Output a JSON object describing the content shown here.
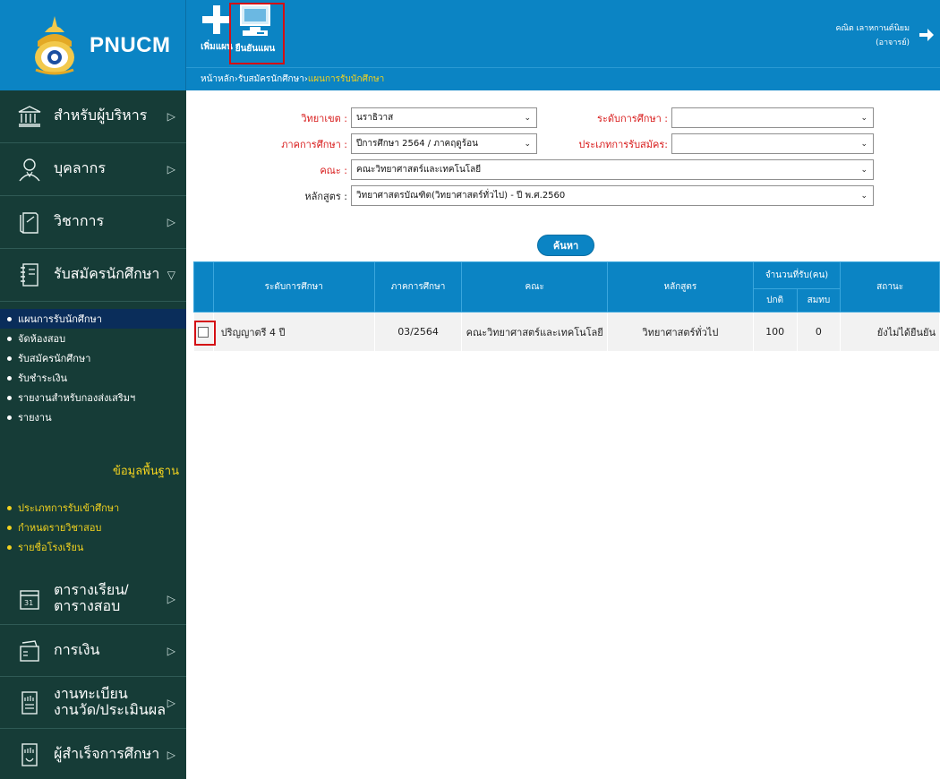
{
  "brand": {
    "name": "PNUCM"
  },
  "toolbar": {
    "add_label": "เพิ่มแผน",
    "confirm_label": "ยืนยันแผน"
  },
  "user": {
    "name": "คณิต เลาหกานต์นิยม",
    "role": "(อาจารย์)"
  },
  "breadcrumb": {
    "home": "หน้าหลัก",
    "sep1": " › ",
    "parent": "รับสมัครนักศึกษา",
    "sep2": " › ",
    "current": "แผนการรับนักศึกษา"
  },
  "sidebar": {
    "items": [
      {
        "label": "สำหรับผู้บริหาร",
        "icon": "bank-icon",
        "arrow": "▷"
      },
      {
        "label": "บุคลากร",
        "icon": "person-icon",
        "arrow": "▷"
      },
      {
        "label": "วิชาการ",
        "icon": "book-icon",
        "arrow": "▷"
      },
      {
        "label": "รับสมัครนักศึกษา",
        "icon": "notebook-icon",
        "arrow": "▽"
      }
    ],
    "submenu": [
      "แผนการรับนักศึกษา",
      "จัดห้องสอบ",
      "รับสมัครนักศึกษา",
      "รับชำระเงิน",
      "รายงานสำหรับกองส่งเสริมฯ",
      "รายงาน"
    ],
    "basic_heading": "ข้อมูลพื้นฐาน",
    "basic_items": [
      "ประเภทการรับเข้าศึกษา",
      "กำหนดรายวิชาสอบ",
      "รายชื่อโรงเรียน"
    ],
    "bottom_items": [
      {
        "label_1": "ตารางเรียน/",
        "label_2": "ตารางสอบ",
        "icon": "calendar-icon",
        "arrow": "▷"
      },
      {
        "label_1": "การเงิน",
        "label_2": "",
        "icon": "wallet-icon",
        "arrow": "▷"
      },
      {
        "label_1": "งานทะเบียน",
        "label_2": "งานวัด/ประเมินผล",
        "icon": "registry-icon",
        "arrow": "▷"
      },
      {
        "label_1": "ผู้สำเร็จการศึกษา",
        "label_2": "",
        "icon": "graduate-icon",
        "arrow": "▷"
      }
    ]
  },
  "form": {
    "campus_label": "วิทยาเขต :",
    "campus_value": "นราธิวาส",
    "level_label": "ระดับการศึกษา :",
    "level_value": "",
    "term_label": "ภาคการศึกษา :",
    "term_value": "ปีการศึกษา 2564 / ภาคฤดูร้อน",
    "apptype_label": "ประเภทการรับสมัคร:",
    "apptype_value": "",
    "faculty_label": "คณะ :",
    "faculty_value": "คณะวิทยาศาสตร์และเทคโนโลยี",
    "program_label": "หลักสูตร :",
    "program_value": "วิทยาศาสตรบัณฑิต(วิทยาศาสตร์ทั่วไป) - ปี พ.ศ.2560",
    "search_label": "ค้นหา"
  },
  "table": {
    "headers": {
      "level": "ระดับการศึกษา",
      "term": "ภาคการศึกษา",
      "faculty": "คณะ",
      "program": "หลักสูตร",
      "quota": "จำนวนที่รับ(คน)",
      "normal": "ปกติ",
      "extra": "สมทบ",
      "status": "สถานะ"
    },
    "rows": [
      {
        "level": "ปริญญาตรี 4 ปี",
        "term": "03/2564",
        "faculty": "คณะวิทยาศาสตร์และเทคโนโลยี",
        "program": "วิทยาศาสตร์ทั่วไป",
        "normal": "100",
        "extra": "0",
        "status": "ยังไม่ได้ยืนยัน"
      }
    ]
  },
  "colors": {
    "primary": "#0b84c4",
    "sidebar": "#163c37",
    "accent_yellow": "#f2d21f",
    "highlight_red": "#d40f14",
    "label_red": "#d81c1c"
  }
}
